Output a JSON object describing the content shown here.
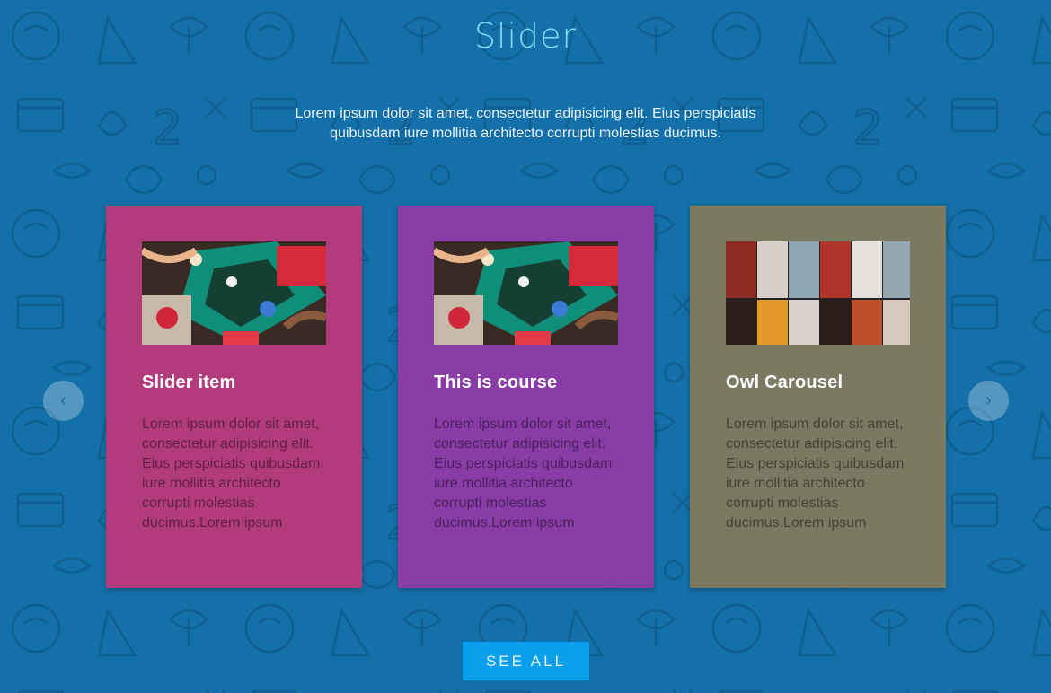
{
  "section": {
    "title": "Slider",
    "intro": "Lorem ipsum dolor sit amet, consectetur adipisicing elit. Eius perspiciatis quibusdam iure mollitia architecto corrupti molestias ducimus."
  },
  "cards": [
    {
      "title": "Slider item",
      "text": "Lorem ipsum dolor sit amet, consectetur adipisicing elit. Eius perspiciatis quibusdam iure mollitia architecto corrupti molestias ducimus.Lorem ipsum",
      "color": "#b23b7c",
      "image": "craft-table-photo"
    },
    {
      "title": "This is course",
      "text": "Lorem ipsum dolor sit amet, consectetur adipisicing elit. Eius perspiciatis quibusdam iure mollitia architecto corrupti molestias ducimus.Lorem ipsum",
      "color": "#8a3ca6",
      "image": "craft-table-photo"
    },
    {
      "title": "Owl Carousel",
      "text": "Lorem ipsum dolor sit amet, consectetur adipisicing elit. Eius perspiciatis quibusdam iure mollitia architecto corrupti molestias ducimus.Lorem ipsum",
      "color": "#7a7a62",
      "image": "lockers-photo"
    }
  ],
  "nav": {
    "prev_label": "‹",
    "next_label": "›"
  },
  "see_all": "SEE ALL",
  "colors": {
    "background": "#1470a8",
    "title": "#7ddcf5",
    "button": "#0aa0ee"
  }
}
